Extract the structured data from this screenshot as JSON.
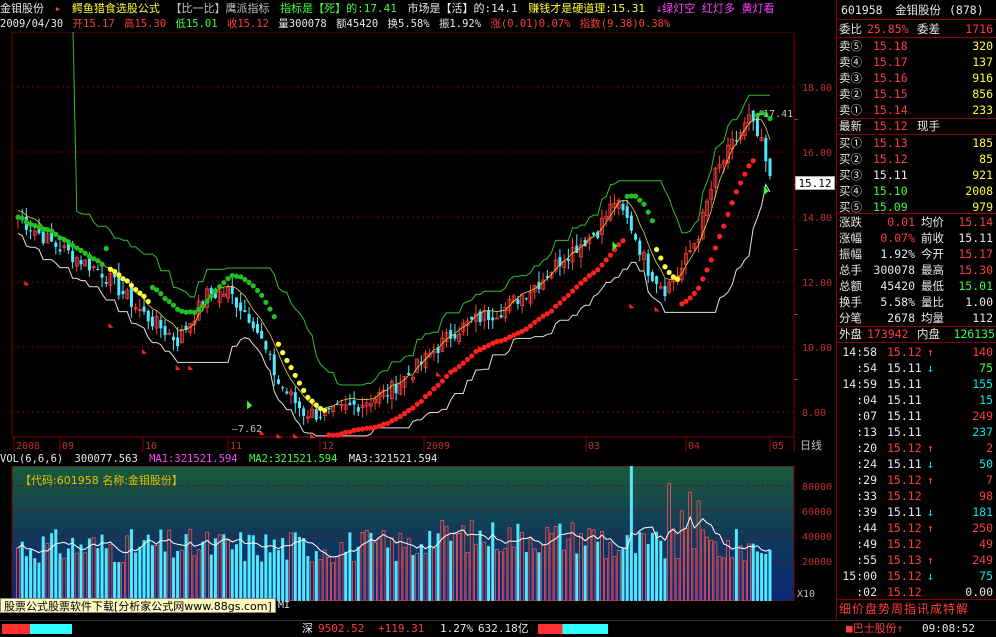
{
  "header": {
    "stock_name": "金钼股份",
    "formula_name": "鳄鱼猎食选股公式",
    "formula_sub": "【比一比】鹰派指标",
    "indicator_label": "指标是【死】的:17.41",
    "market_label": "市场是【活】的:14.1",
    "money_label": "赚钱才是硬道理:15.31",
    "light_labels": "↓绿灯空 红灯多 黄灯看",
    "arrow": "⬇"
  },
  "info": {
    "date": "2009/04/30",
    "open": "开15.17",
    "high": "高15.30",
    "low": "低15.01",
    "close": "收15.12",
    "volume": "量300078",
    "amount": "额45420",
    "turnover": "换5.58%",
    "amplitude": "振1.92%",
    "change": "涨(0.01)0.07%",
    "index": "指数(9.38)0.38%"
  },
  "main_chart": {
    "y_ticks": [
      "18.00",
      "16.00",
      "14.00",
      "12.00",
      "10.00",
      "8.00"
    ],
    "y_values": [
      18,
      16,
      14,
      12,
      10,
      8
    ],
    "x_labels": [
      "2008",
      "09",
      "10",
      "11",
      "12",
      "2009",
      "03",
      "04",
      "05"
    ],
    "last_price_tag": "15.12",
    "high_annot": "17.41",
    "low_annot": "7.62",
    "bottom_right_label": "日线"
  },
  "volume": {
    "label": "VOL(6,6,6)",
    "vol_value": "300077.563",
    "ma1": "MA1:321521.594",
    "ma2": "MA2:321521.594",
    "ma3": "MA3:321521.594",
    "code_label": "【代码:601958 名称:金钼股份】",
    "y_ticks": [
      "80000",
      "60000",
      "40000",
      "20000"
    ],
    "y_values": [
      80000,
      60000,
      40000,
      20000
    ],
    "x10": "X10"
  },
  "ad_text": "股票公式股票软件下载[分析家公式网www.88gs.com]",
  "ad_tail": "MI",
  "right_panel": {
    "code": "601958",
    "name": "金钼股份",
    "num": "(878)",
    "weibi_label": "委比",
    "weibi_value": "25.85%",
    "weicha_label": "委差",
    "weicha_value": "1716",
    "asks": [
      {
        "label": "卖⑤",
        "price": "15.18",
        "vol": "320"
      },
      {
        "label": "卖④",
        "price": "15.17",
        "vol": "137"
      },
      {
        "label": "卖③",
        "price": "15.16",
        "vol": "916"
      },
      {
        "label": "卖②",
        "price": "15.15",
        "vol": "856"
      },
      {
        "label": "卖①",
        "price": "15.14",
        "vol": "233"
      }
    ],
    "latest_label": "最新",
    "latest_value": "15.12",
    "current_hand_label": "现手",
    "bids": [
      {
        "label": "买①",
        "price": "15.13",
        "vol": "185"
      },
      {
        "label": "买②",
        "price": "15.12",
        "vol": "85"
      },
      {
        "label": "买③",
        "price": "15.11",
        "vol": "921"
      },
      {
        "label": "买④",
        "price": "15.10",
        "vol": "2008"
      },
      {
        "label": "买⑤",
        "price": "15.09",
        "vol": "979"
      }
    ],
    "stats": [
      {
        "l1": "涨跌",
        "v1": "0.01",
        "c1": "red",
        "l2": "均价",
        "v2": "15.14",
        "c2": "red"
      },
      {
        "l1": "涨幅",
        "v1": "0.07%",
        "c1": "red",
        "l2": "前收",
        "v2": "15.11",
        "c2": "white"
      },
      {
        "l1": "振幅",
        "v1": "1.92%",
        "c1": "white",
        "l2": "今开",
        "v2": "15.17",
        "c2": "red"
      },
      {
        "l1": "总手",
        "v1": "300078",
        "c1": "white",
        "l2": "最高",
        "v2": "15.30",
        "c2": "red"
      },
      {
        "l1": "总额",
        "v1": "45420",
        "c1": "white",
        "l2": "最低",
        "v2": "15.01",
        "c2": "green"
      },
      {
        "l1": "换手",
        "v1": "5.58%",
        "c1": "white",
        "l2": "量比",
        "v2": "1.00",
        "c2": "white"
      },
      {
        "l1": "分笔",
        "v1": "2678",
        "c1": "white",
        "l2": "均量",
        "v2": "112",
        "c2": "white"
      }
    ],
    "outer_label": "外盘",
    "outer_value": "173942",
    "inner_label": "内盘",
    "inner_value": "126135",
    "ticks": [
      {
        "t": "14:58",
        "p": "15.12",
        "d": "↑",
        "v": "140",
        "c": "red"
      },
      {
        "t": ":54",
        "p": "15.11",
        "d": "↓",
        "v": "75",
        "c": "green"
      },
      {
        "t": "14:59",
        "p": "15.11",
        "d": "",
        "v": "155",
        "c": "cyan"
      },
      {
        "t": ":04",
        "p": "15.11",
        "d": "",
        "v": "15",
        "c": "cyan"
      },
      {
        "t": ":07",
        "p": "15.11",
        "d": "",
        "v": "249",
        "c": "red"
      },
      {
        "t": ":13",
        "p": "15.11",
        "d": "",
        "v": "237",
        "c": "cyan"
      },
      {
        "t": ":20",
        "p": "15.12",
        "d": "↑",
        "v": "2",
        "c": "red"
      },
      {
        "t": ":24",
        "p": "15.11",
        "d": "↓",
        "v": "50",
        "c": "cyan"
      },
      {
        "t": ":29",
        "p": "15.12",
        "d": "↑",
        "v": "7",
        "c": "red"
      },
      {
        "t": ":33",
        "p": "15.12",
        "d": "",
        "v": "98",
        "c": "red"
      },
      {
        "t": ":39",
        "p": "15.11",
        "d": "↓",
        "v": "181",
        "c": "cyan"
      },
      {
        "t": ":44",
        "p": "15.12",
        "d": "↑",
        "v": "250",
        "c": "red"
      },
      {
        "t": ":49",
        "p": "15.12",
        "d": "",
        "v": "49",
        "c": "red"
      },
      {
        "t": ":55",
        "p": "15.13",
        "d": "↑",
        "v": "249",
        "c": "red"
      },
      {
        "t": "15:00",
        "p": "15.12",
        "d": "↓",
        "v": "75",
        "c": "cyan"
      },
      {
        "t": ":02",
        "p": "15.12",
        "d": "",
        "v": "0.00",
        "c": "white"
      }
    ],
    "tabs": "细价盘势周指讯成特解"
  },
  "status": {
    "index_name": "深",
    "index_value": "9502.52",
    "index_change": "+119.31",
    "index_pct": "1.27%",
    "index_amount": "632.18亿",
    "right_stock": "巴士股份",
    "arrow": "↑",
    "time": "09:08:52"
  }
}
